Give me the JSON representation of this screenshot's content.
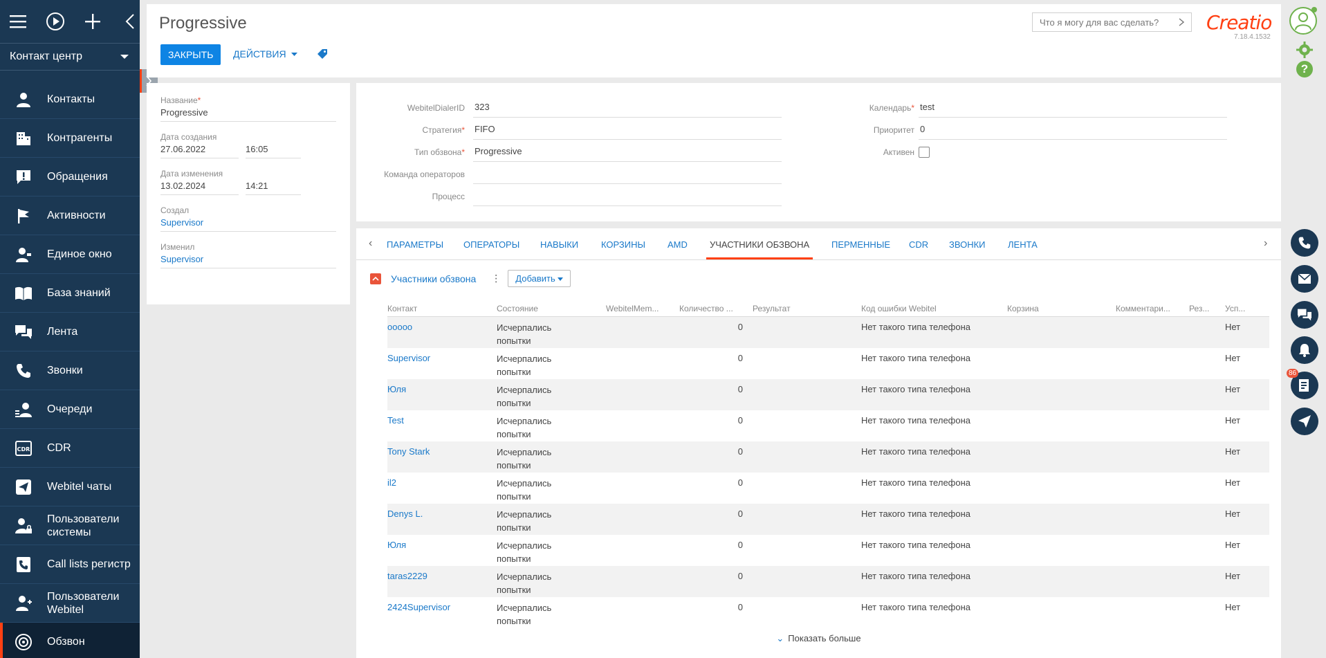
{
  "sidebar": {
    "workplace": "Контакт центр",
    "items": [
      {
        "label": "Контакты",
        "icon": "person-icon"
      },
      {
        "label": "Контрагенты",
        "icon": "building-icon"
      },
      {
        "label": "Обращения",
        "icon": "exclamation-icon"
      },
      {
        "label": "Активности",
        "icon": "flag-icon"
      },
      {
        "label": "Единое окно",
        "icon": "person-window-icon"
      },
      {
        "label": "База знаний",
        "icon": "book-icon"
      },
      {
        "label": "Лента",
        "icon": "feed-icon"
      },
      {
        "label": "Звонки",
        "icon": "phone-icon"
      },
      {
        "label": "Очереди",
        "icon": "queue-icon"
      },
      {
        "label": "CDR",
        "icon": "cdr-icon"
      },
      {
        "label": "Webitel чаты",
        "icon": "send-icon"
      },
      {
        "label": "Пользователи системы",
        "icon": "user-lock-icon"
      },
      {
        "label": "Call lists регистр",
        "icon": "calllist-icon"
      },
      {
        "label": "Пользователи Webitel",
        "icon": "users-icon"
      },
      {
        "label": "Обзвон",
        "icon": "dialer-icon"
      }
    ]
  },
  "header": {
    "title": "Progressive",
    "close_label": "ЗАКРЫТЬ",
    "actions_label": "ДЕЙСТВИЯ",
    "search_placeholder": "Что я могу для вас сделать?",
    "logo": "Creatio",
    "version": "7.18.4.1532"
  },
  "left_card": {
    "name_label": "Название",
    "name_value": "Progressive",
    "created_label": "Дата создания",
    "created_date": "27.06.2022",
    "created_time": "16:05",
    "modified_label": "Дата изменения",
    "modified_date": "13.02.2024",
    "modified_time": "14:21",
    "created_by_label": "Создал",
    "created_by_value": "Supervisor",
    "modified_by_label": "Изменил",
    "modified_by_value": "Supervisor"
  },
  "main_fields": {
    "dialer_id_label": "WebitelDialerID",
    "dialer_id_value": "323",
    "strategy_label": "Стратегия",
    "strategy_value": "FIFO",
    "type_label": "Тип обзвона",
    "type_value": "Progressive",
    "team_label": "Команда операторов",
    "team_value": "",
    "process_label": "Процесс",
    "process_value": "",
    "calendar_label": "Календарь",
    "calendar_value": "test",
    "priority_label": "Приоритет",
    "priority_value": "0",
    "active_label": "Активен",
    "active_checked": false
  },
  "tabs": [
    "ПАРАМЕТРЫ",
    "ОПЕРАТОРЫ",
    "НАВЫКИ",
    "КОРЗИНЫ",
    "AMD",
    "УЧАСТНИКИ ОБЗВОНА",
    "ПЕРМЕННЫЕ",
    "CDR",
    "ЗВОНКИ",
    "ЛЕНТА"
  ],
  "active_tab": "УЧАСТНИКИ ОБЗВОНА",
  "detail": {
    "title": "Участники обзвона",
    "add_label": "Добавить",
    "columns": [
      "Контакт",
      "Состояние",
      "WebitelMem...",
      "Количество ...",
      "Результат",
      "Код ошибки Webitel",
      "Корзина",
      "Комментари...",
      "Рез...",
      "Усп..."
    ],
    "rows": [
      {
        "contact": "ooooo",
        "state": "Исчерпались попытки",
        "count": "0",
        "error": "Нет такого типа телефона",
        "success": "Нет"
      },
      {
        "contact": "Supervisor",
        "state": "Исчерпались попытки",
        "count": "0",
        "error": "Нет такого типа телефона",
        "success": "Нет"
      },
      {
        "contact": "Юля",
        "state": "Исчерпались попытки",
        "count": "0",
        "error": "Нет такого типа телефона",
        "success": "Нет"
      },
      {
        "contact": "Test",
        "state": "Исчерпались попытки",
        "count": "0",
        "error": "Нет такого типа телефона",
        "success": "Нет"
      },
      {
        "contact": "Tony Stark",
        "state": "Исчерпались попытки",
        "count": "0",
        "error": "Нет такого типа телефона",
        "success": "Нет"
      },
      {
        "contact": "il2",
        "state": "Исчерпались попытки",
        "count": "0",
        "error": "Нет такого типа телефона",
        "success": "Нет"
      },
      {
        "contact": "Denys L.",
        "state": "Исчерпались попытки",
        "count": "0",
        "error": "Нет такого типа телефона",
        "success": "Нет"
      },
      {
        "contact": "Юля",
        "state": "Исчерпались попытки",
        "count": "0",
        "error": "Нет такого типа телефона",
        "success": "Нет"
      },
      {
        "contact": "taras2229",
        "state": "Исчерпались попытки",
        "count": "0",
        "error": "Нет такого типа телефона",
        "success": "Нет"
      },
      {
        "contact": "2424Supervisor",
        "state": "Исчерпались попытки",
        "count": "0",
        "error": "Нет такого типа телефона",
        "success": "Нет"
      }
    ],
    "show_more": "Показать больше"
  },
  "rail": {
    "notification_count": "86"
  },
  "colors": {
    "sidebar": "#1b3853",
    "accent": "#ff4013",
    "link": "#1a79c9",
    "primary_button": "#0e84e4"
  }
}
